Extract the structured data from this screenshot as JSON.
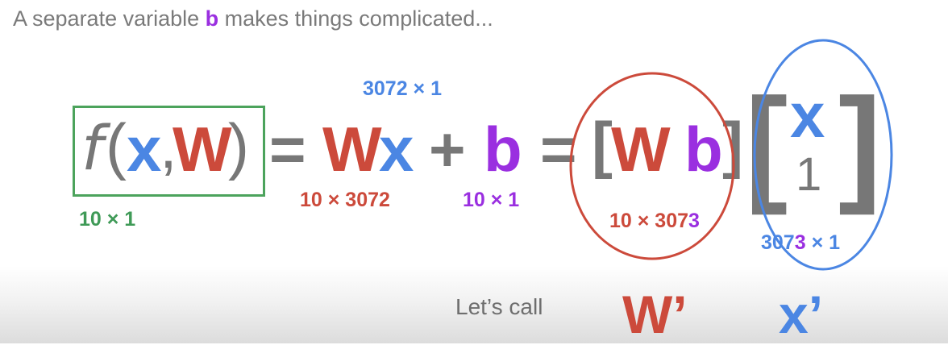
{
  "title": {
    "before": "A separate variable ",
    "highlight": "b",
    "after": " makes things complicated..."
  },
  "equation": {
    "f": "f",
    "open_paren": "(",
    "x": "x",
    "comma": ",",
    "W": "W",
    "close_paren": ")",
    "eq1": "=",
    "Wx_W": "W",
    "Wx_x": "x",
    "plus": "+",
    "b": "b",
    "eq2": "=",
    "bracket_left": "[",
    "Wb_W": "W",
    "Wb_b": "b",
    "bracket_right": "]",
    "vec_bracket_left": "[",
    "vec_x": "x",
    "vec_one": "1",
    "vec_bracket_right": "]"
  },
  "dimensions": {
    "f_out": "10 × 1",
    "x_dim": "3072 × 1",
    "W_dim": "10 × 3072",
    "b_dim": "10 × 1",
    "Wb_dim_a": "10 × 307",
    "Wb_dim_b": "3",
    "xvec_dim_a": "307",
    "xvec_dim_b": "3",
    "xvec_dim_c": " × 1"
  },
  "footer": {
    "lets_call": "Let’s call",
    "W_prime": "W’",
    "x_prime": "x’"
  },
  "colors": {
    "blue": "#4b86e3",
    "red": "#cc4a3b",
    "purple": "#9a2fe0",
    "green": "#3f9a57",
    "grey": "#777777"
  }
}
